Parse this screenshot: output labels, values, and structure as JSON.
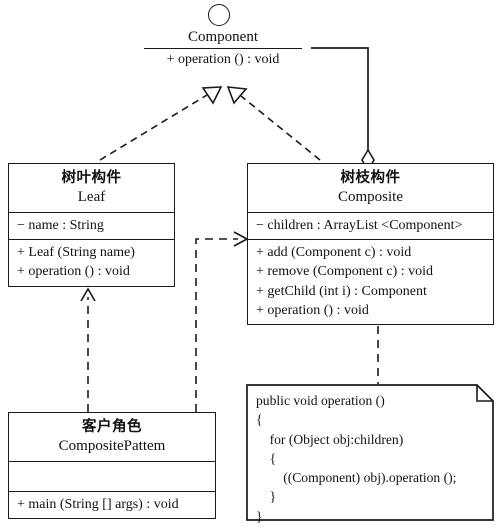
{
  "diagram": {
    "title": "Composite Pattern UML Class Diagram",
    "line_color": "#1a1a1a",
    "background": "#ffffff"
  },
  "interface": {
    "icon": "circle-icon",
    "name": "Component",
    "operation": "+ operation () : void"
  },
  "classes": {
    "leaf": {
      "cn_name": "树叶构件",
      "en_name": "Leaf",
      "attributes": [
        "− name : String"
      ],
      "methods": [
        "+ Leaf (String name)",
        "+ operation () : void"
      ]
    },
    "composite": {
      "cn_name": "树枝构件",
      "en_name": "Composite",
      "attributes": [
        "− children : ArrayList <Component>"
      ],
      "methods": [
        "+ add (Component c) : void",
        "+ remove (Component c) : void",
        "+ getChild (int i) : Component",
        "+ operation () : void"
      ]
    },
    "client": {
      "cn_name": "客户角色",
      "en_name": "CompositePattem",
      "attributes": [],
      "methods": [
        "+ main (String [] args) : void"
      ]
    }
  },
  "note": {
    "name": "code-note",
    "code": "public void operation ()\n{\n    for (Object obj:children)\n    {\n        ((Component) obj).operation ();\n    }\n}"
  },
  "relations": [
    {
      "name": "leaf-realizes-component",
      "type": "realization",
      "from": "Leaf",
      "to": "Component",
      "style": "dashed",
      "arrowhead": "hollow-triangle"
    },
    {
      "name": "composite-realizes-component",
      "type": "realization",
      "from": "Composite",
      "to": "Component",
      "style": "dashed",
      "arrowhead": "hollow-triangle"
    },
    {
      "name": "composite-aggregates-component",
      "type": "aggregation",
      "from": "Composite",
      "to": "Component",
      "style": "solid",
      "arrowhead": "hollow-diamond"
    },
    {
      "name": "client-depends-leaf",
      "type": "dependency",
      "from": "CompositePattem",
      "to": "Leaf",
      "style": "dashed",
      "arrowhead": "open-arrow"
    },
    {
      "name": "client-depends-composite",
      "type": "dependency",
      "from": "CompositePattem",
      "to": "Composite",
      "style": "dashed",
      "arrowhead": "open-arrow"
    },
    {
      "name": "note-anchor-composite",
      "type": "note-anchor",
      "from": "code-note",
      "to": "Composite",
      "style": "dashed",
      "arrowhead": "none"
    }
  ]
}
